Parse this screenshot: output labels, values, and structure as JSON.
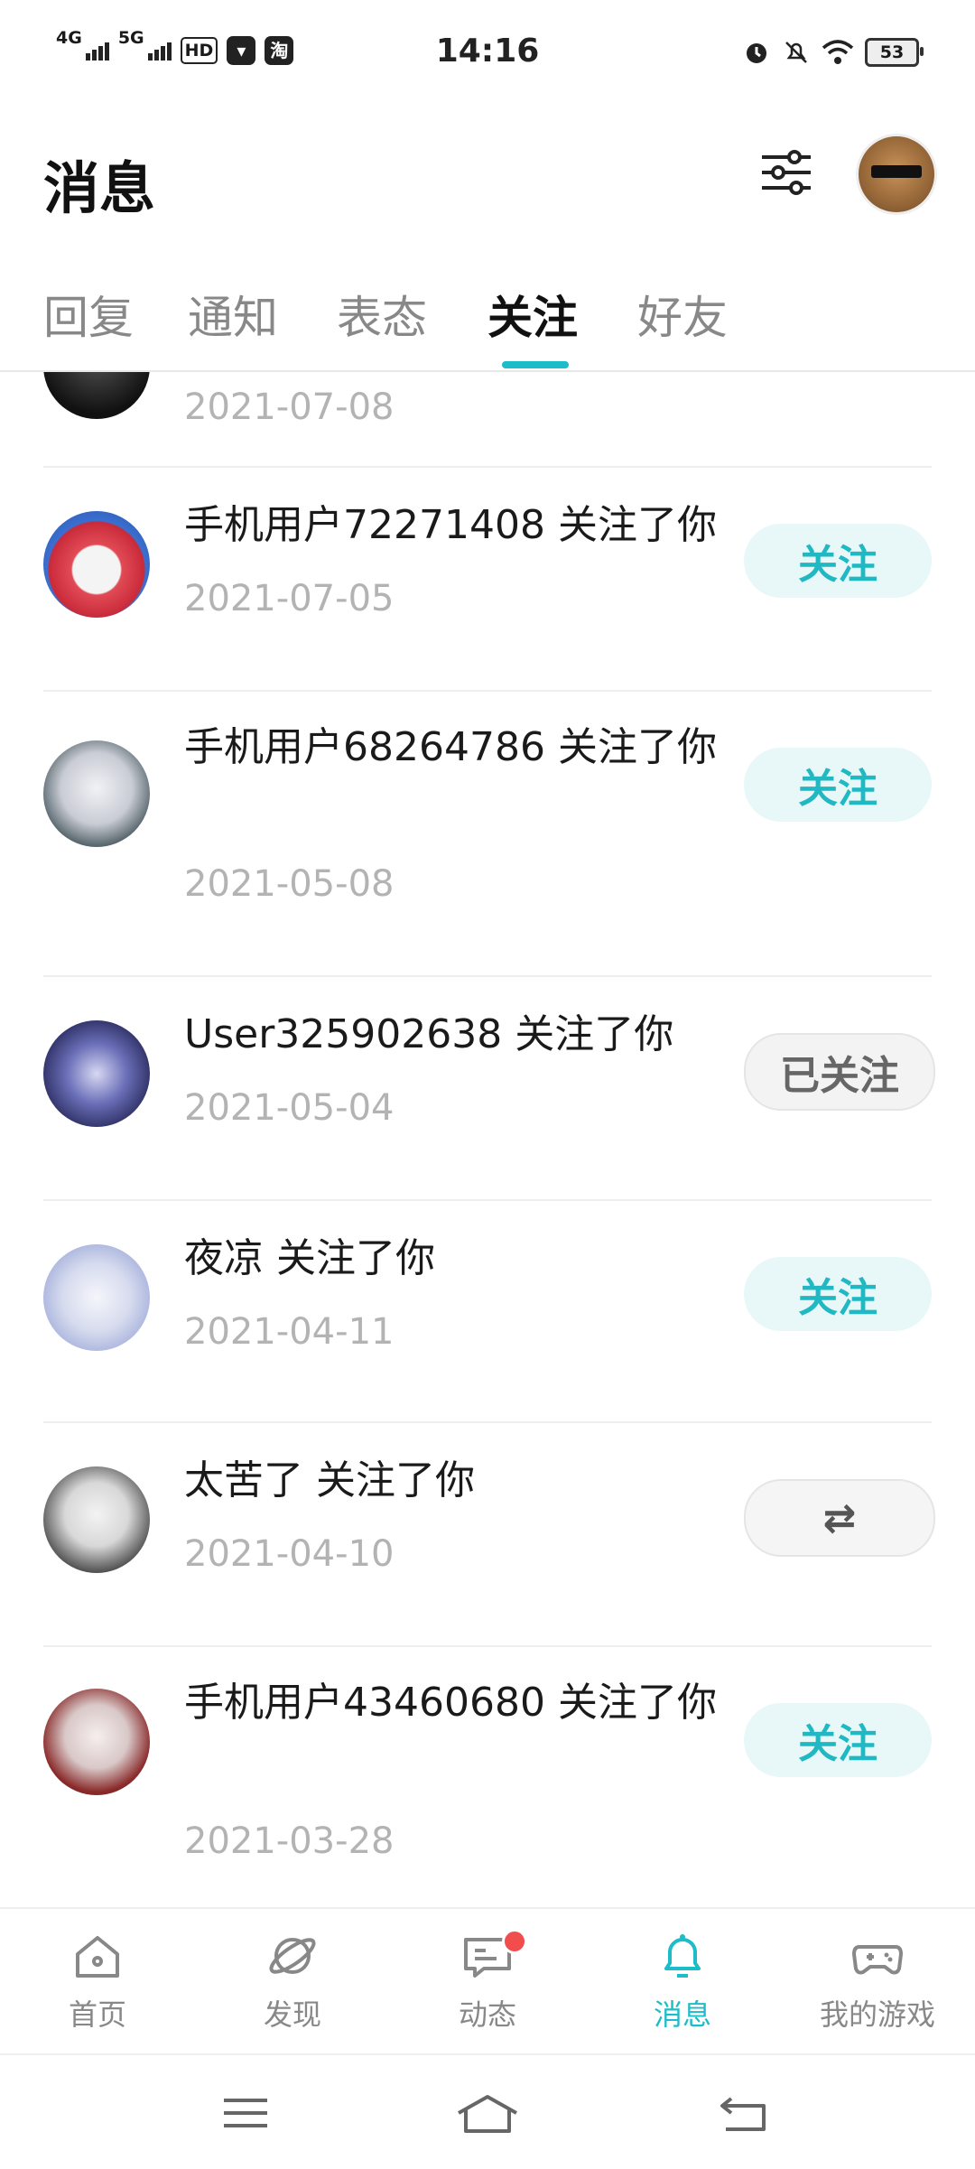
{
  "status_bar": {
    "time": "14:16",
    "network1": "4G",
    "network2": "5G",
    "hd": "HD",
    "app_icon_text": "淘",
    "battery": "53"
  },
  "header": {
    "title": "消息"
  },
  "tabs": [
    {
      "label": "回复"
    },
    {
      "label": "通知"
    },
    {
      "label": "表态"
    },
    {
      "label": "关注"
    },
    {
      "label": "好友"
    }
  ],
  "active_tab": "关注",
  "list": [
    {
      "text": "",
      "date": "2021-07-08",
      "button": ""
    },
    {
      "text": "手机用户72271408 关注了你",
      "date": "2021-07-05",
      "button": "关注"
    },
    {
      "text": "手机用户68264786 关注了你",
      "date": "2021-05-08",
      "button": "关注"
    },
    {
      "text": "User325902638 关注了你",
      "date": "2021-05-04",
      "button": "已关注"
    },
    {
      "text": "夜凉 关注了你",
      "date": "2021-04-11",
      "button": "关注"
    },
    {
      "text": "太苦了 关注了你",
      "date": "2021-04-10",
      "button": "⇄"
    },
    {
      "text": "手机用户43460680 关注了你",
      "date": "2021-03-28",
      "button": "关注"
    }
  ],
  "bottom_nav": [
    {
      "label": "首页",
      "icon": "home-icon"
    },
    {
      "label": "发现",
      "icon": "planet-icon"
    },
    {
      "label": "动态",
      "icon": "chat-icon"
    },
    {
      "label": "消息",
      "icon": "bell-icon"
    },
    {
      "label": "我的游戏",
      "icon": "gamepad-icon"
    }
  ],
  "colors": {
    "accent": "#1cbcc8",
    "badge": "#f24d4d"
  }
}
